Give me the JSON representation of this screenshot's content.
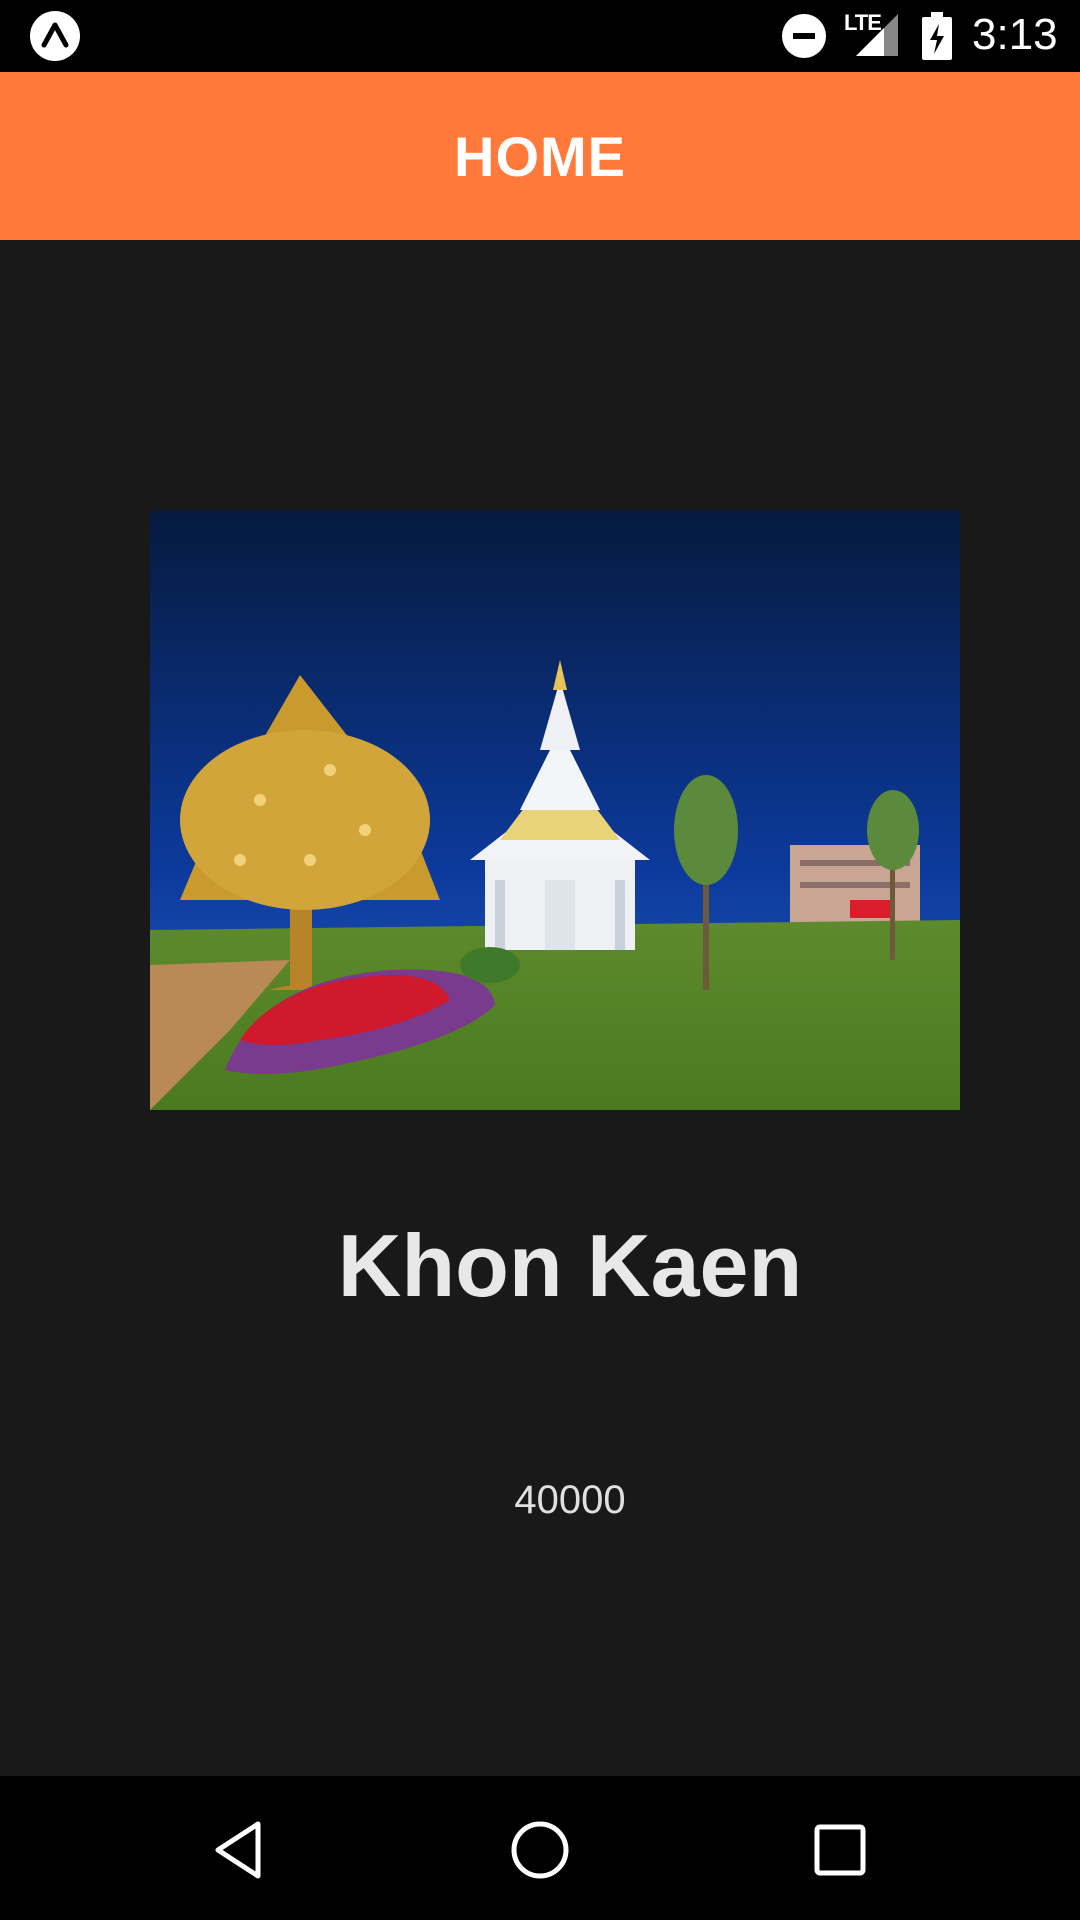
{
  "status_bar": {
    "time": "3:13",
    "network": "LTE",
    "icons": [
      "app-badge-icon",
      "do-not-disturb-icon",
      "signal-icon",
      "battery-charging-icon"
    ]
  },
  "app_bar": {
    "title": "HOME",
    "color": "#ff7a3a"
  },
  "place": {
    "name": "Khon Kaen",
    "postal_code": "40000"
  },
  "nav_bar": {
    "icons": [
      "back-icon",
      "home-icon",
      "recents-icon"
    ]
  }
}
